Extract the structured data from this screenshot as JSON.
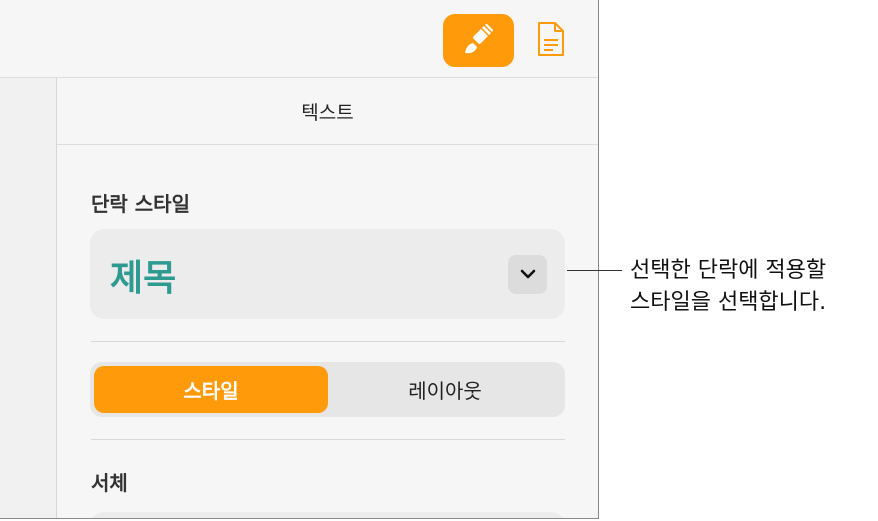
{
  "toolbar": {
    "format_button_icon": "paintbrush-icon",
    "document_button_icon": "document-icon",
    "accent_color": "#ff9a0a"
  },
  "panel": {
    "header_title": "텍스트",
    "paragraph_style": {
      "label": "단락 스타일",
      "selected_value": "제목",
      "value_color": "#2f9a92"
    },
    "segmented_control": {
      "options": [
        "스타일",
        "레이아웃"
      ],
      "selected_index": 0
    },
    "font_section": {
      "label": "서체"
    }
  },
  "callout": {
    "line1": "선택한 단락에 적용할",
    "line2": "스타일을 선택합니다."
  }
}
